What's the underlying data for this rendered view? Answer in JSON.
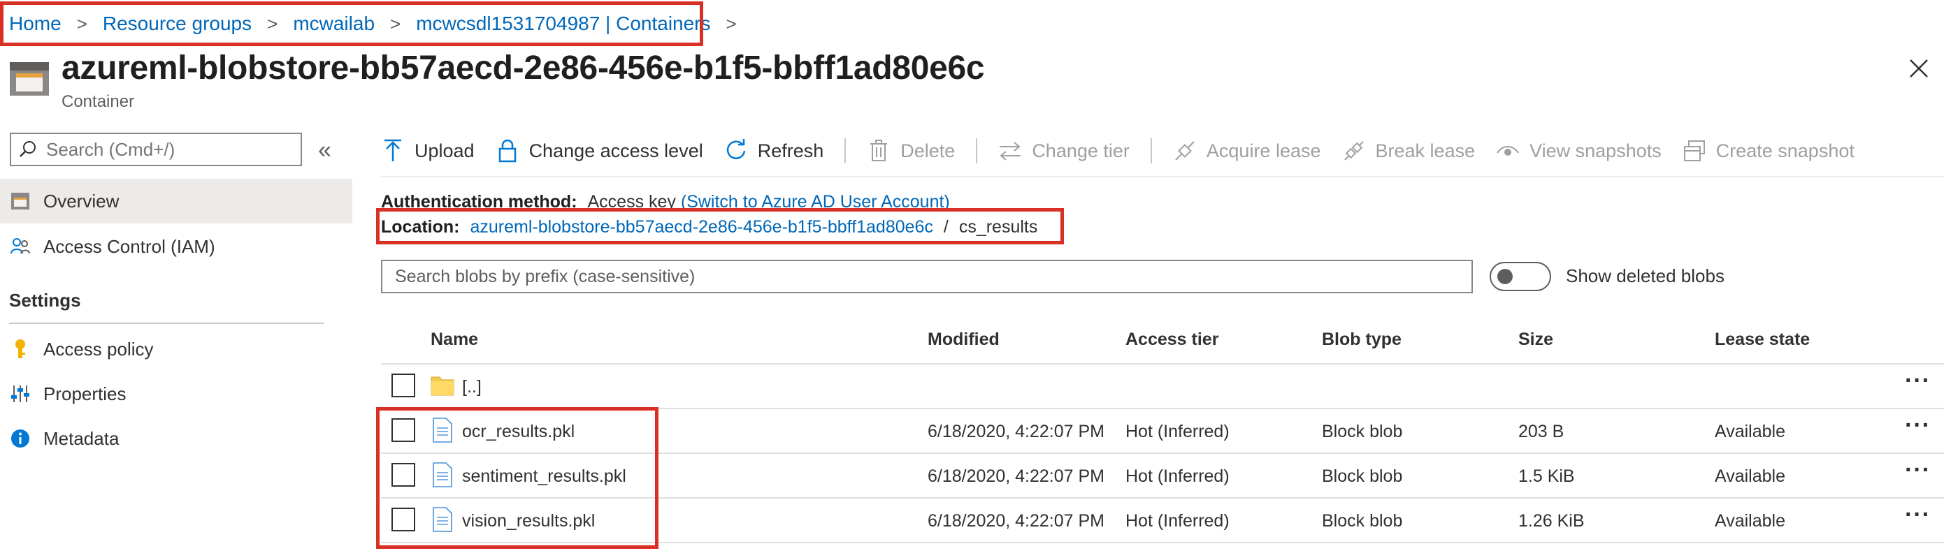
{
  "breadcrumb": {
    "items": [
      "Home",
      "Resource groups",
      "mcwailab",
      "mcwcsdl1531704987 | Containers"
    ],
    "separator": ">"
  },
  "header": {
    "title": "azureml-blobstore-bb57aecd-2e86-456e-b1f5-bbff1ad80e6c",
    "subtitle": "Container",
    "close_symbol": "✕"
  },
  "sidebar": {
    "search_placeholder": "Search (Cmd+/)",
    "collapse_symbol": "«",
    "items": [
      {
        "label": "Overview",
        "icon": "container-icon",
        "active": true
      },
      {
        "label": "Access Control (IAM)",
        "icon": "people-icon",
        "active": false
      }
    ],
    "section_title": "Settings",
    "settings_items": [
      {
        "label": "Access policy",
        "icon": "key-icon"
      },
      {
        "label": "Properties",
        "icon": "sliders-icon"
      },
      {
        "label": "Metadata",
        "icon": "info-icon"
      }
    ]
  },
  "toolbar": {
    "upload": "Upload",
    "change_access": "Change access level",
    "refresh": "Refresh",
    "delete": "Delete",
    "change_tier": "Change tier",
    "acquire_lease": "Acquire lease",
    "break_lease": "Break lease",
    "view_snapshots": "View snapshots",
    "create_snapshot": "Create snapshot"
  },
  "info": {
    "auth_label": "Authentication method:",
    "auth_value": "Access key",
    "auth_switch": "(Switch to Azure AD User Account)",
    "location_label": "Location:",
    "location_link": "azureml-blobstore-bb57aecd-2e86-456e-b1f5-bbff1ad80e6c",
    "location_sep": "/",
    "location_folder": "cs_results"
  },
  "blob_search": {
    "placeholder": "Search blobs by prefix (case-sensitive)"
  },
  "show_deleted": {
    "label": "Show deleted blobs",
    "on": false
  },
  "table": {
    "headers": {
      "name": "Name",
      "modified": "Modified",
      "access_tier": "Access tier",
      "blob_type": "Blob type",
      "size": "Size",
      "lease_state": "Lease state"
    },
    "parent_row": {
      "name": "[..]"
    },
    "more_symbol": "···",
    "rows": [
      {
        "name": "ocr_results.pkl",
        "modified": "6/18/2020, 4:22:07 PM",
        "access_tier": "Hot (Inferred)",
        "blob_type": "Block blob",
        "size": "203 B",
        "lease_state": "Available"
      },
      {
        "name": "sentiment_results.pkl",
        "modified": "6/18/2020, 4:22:07 PM",
        "access_tier": "Hot (Inferred)",
        "blob_type": "Block blob",
        "size": "1.5 KiB",
        "lease_state": "Available"
      },
      {
        "name": "vision_results.pkl",
        "modified": "6/18/2020, 4:22:07 PM",
        "access_tier": "Hot (Inferred)",
        "blob_type": "Block blob",
        "size": "1.26 KiB",
        "lease_state": "Available"
      }
    ]
  },
  "colors": {
    "link": "#0067b8",
    "highlight_box": "#d93025",
    "active_nav": "#edebe9",
    "folder": "#f2c94c"
  }
}
